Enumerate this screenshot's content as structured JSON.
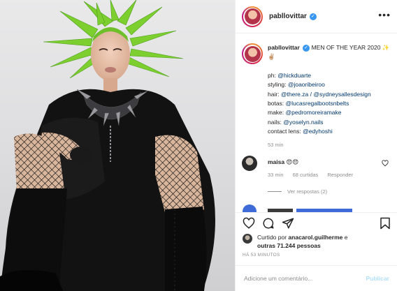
{
  "post": {
    "username": "pabllovittar",
    "verified_badge": "✓"
  },
  "icons": {
    "more": "more-options-icon",
    "heart": "heart-icon",
    "comment": "comment-icon",
    "share": "share-icon",
    "save": "bookmark-icon"
  },
  "caption": {
    "username": "pabllovittar",
    "headline": "MEN OF THE YEAR 2020 ✨✌🏼",
    "credits": [
      {
        "label": "ph: ",
        "mention": "@hickduarte"
      },
      {
        "label": "styling: ",
        "mention": "@joaoribeiroo"
      },
      {
        "label": "hair: ",
        "mention": "@there.za / @sydneysallesdesign"
      },
      {
        "label": "botas: ",
        "mention": "@lucasregalbootsnbelts"
      },
      {
        "label": "make: ",
        "mention": "@pedromoreiramake"
      },
      {
        "label": "nails: ",
        "mention": "@yoselyn.nails"
      },
      {
        "label": "contact lens: ",
        "mention": "@edyhoshi"
      }
    ],
    "time": "53 min"
  },
  "comment": {
    "username": "maisa",
    "text": "😍😍",
    "time": "33 min",
    "likes": "68 curtidas",
    "reply": "Responder",
    "view_replies": "Ver respostas (2)"
  },
  "likes": {
    "prefix": "Curtido por ",
    "user": "anacarol.guilherme",
    "conj": " e",
    "others": "outras 71.244 pessoas"
  },
  "timestamp": "HÁ 53 MINUTOS",
  "add_comment": {
    "placeholder": "Adicione um comentário...",
    "post_label": "Publicar"
  },
  "colors": {
    "accent_blue": "#3897f0",
    "mention": "#00376b",
    "muted": "#8e8e8e",
    "hair_green": "#7ccf2f"
  }
}
